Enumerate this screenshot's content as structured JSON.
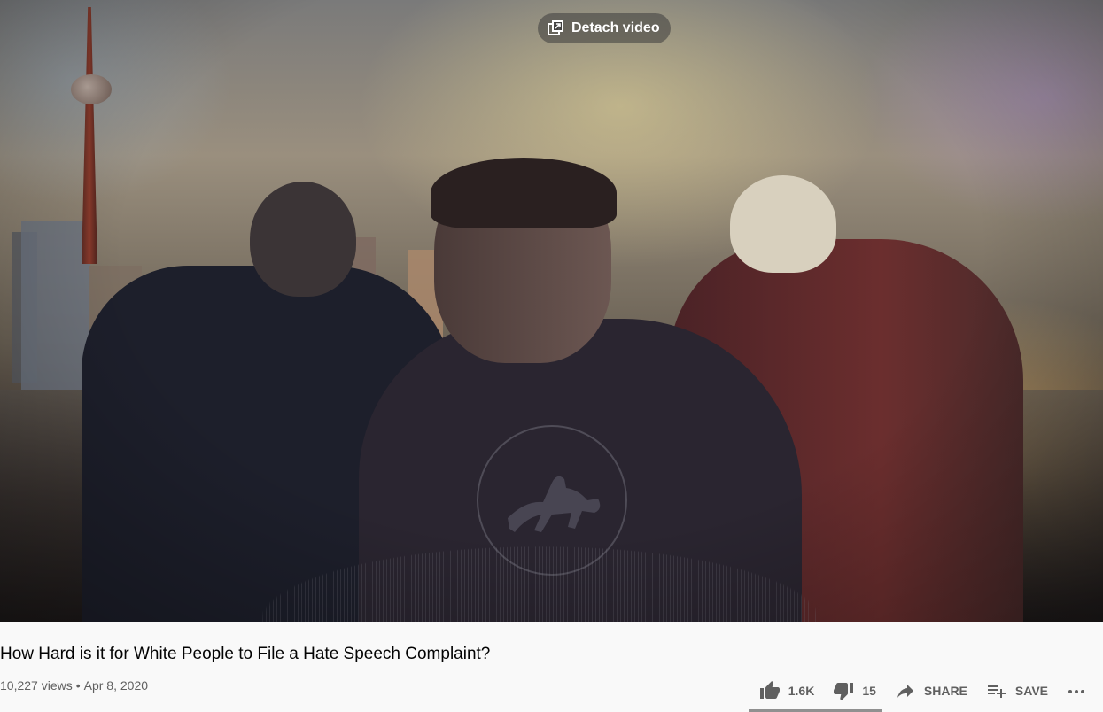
{
  "player": {
    "detach_label": "Detach video",
    "detach_icon": "picture-in-picture-icon"
  },
  "video": {
    "title": "How Hard is it for White People to File a Hate Speech Complaint?",
    "views": "10,227 views",
    "separator": "•",
    "date": "Apr 8, 2020"
  },
  "actions": {
    "like_count": "1.6K",
    "dislike_count": "15",
    "share_label": "SHARE",
    "save_label": "SAVE",
    "like_icon": "thumbs-up-icon",
    "dislike_icon": "thumbs-down-icon",
    "share_icon": "share-arrow-icon",
    "save_icon": "playlist-add-icon",
    "more_icon": "more-horizontal-icon",
    "like_ratio": 0.99
  },
  "colors": {
    "text_primary": "#030303",
    "text_secondary": "#606060",
    "background": "#f9f9f9"
  }
}
